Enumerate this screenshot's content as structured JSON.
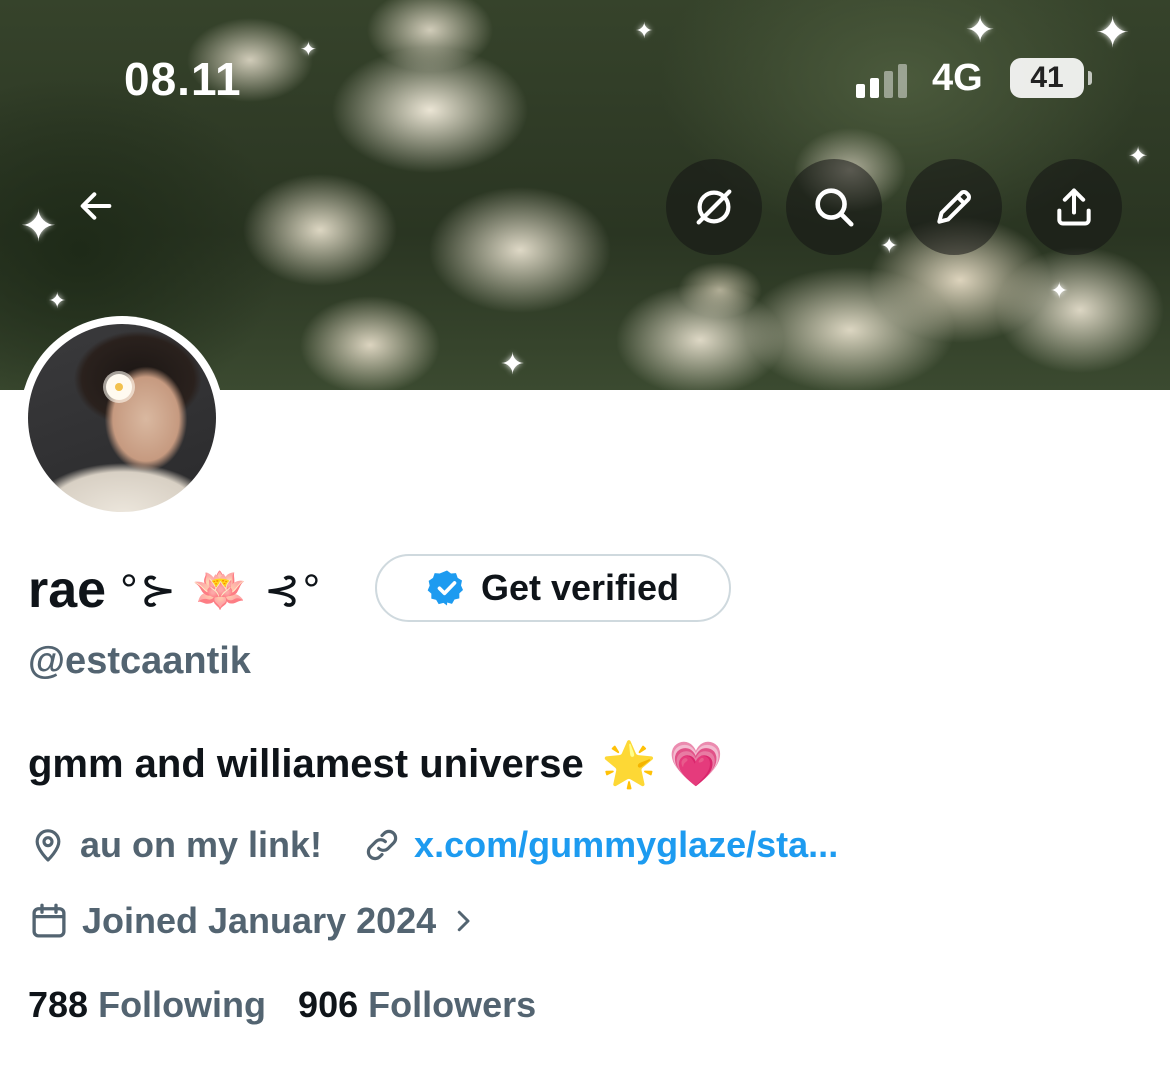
{
  "status_bar": {
    "time": "08.11",
    "network": "4G",
    "battery": "41"
  },
  "header": {
    "back_icon": "arrow-left-icon",
    "actions": [
      "grok-icon",
      "search-icon",
      "pencil-icon",
      "share-icon"
    ]
  },
  "profile": {
    "name": "rae",
    "name_decoration": "°⊱ 🪷 ⊰°",
    "get_verified_label": "Get verified",
    "handle": "@estcaantik",
    "bio_text": "gmm and williamest universe",
    "bio_emojis": "🌟 💗",
    "location": "au on my link!",
    "link": "x.com/gummyglaze/sta...",
    "joined": "Joined January 2024",
    "following_count": "788",
    "following_label": "Following",
    "followers_count": "906",
    "followers_label": "Followers"
  },
  "colors": {
    "accent": "#1d9bf0",
    "secondary_text": "#536471",
    "primary_text": "#0f1419"
  }
}
